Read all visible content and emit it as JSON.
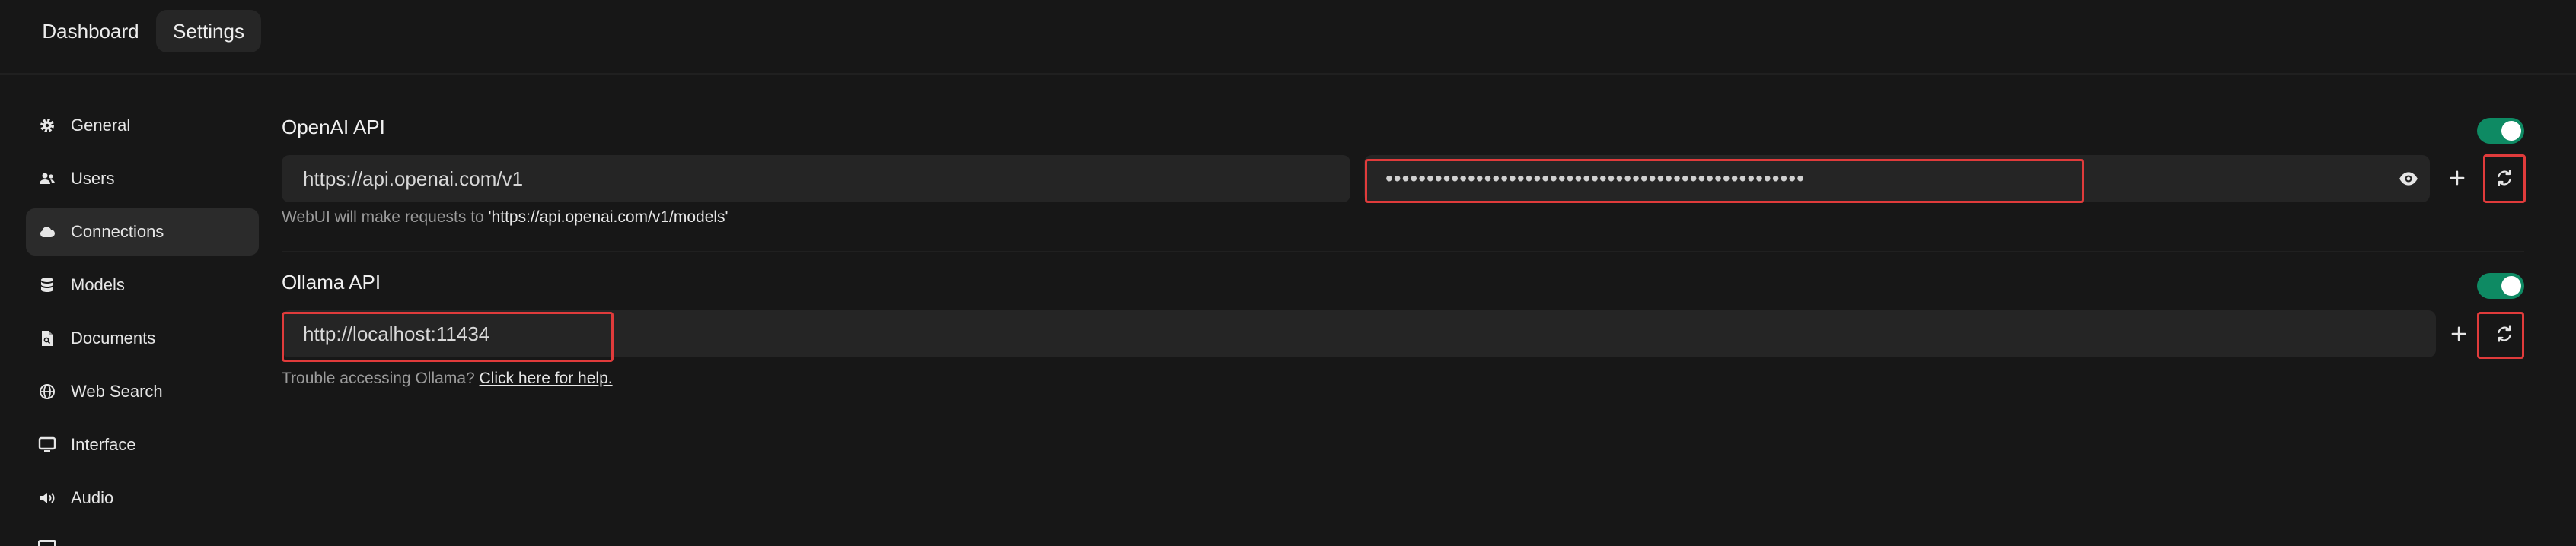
{
  "nav": {
    "tabs": [
      {
        "label": "Dashboard"
      },
      {
        "label": "Settings"
      }
    ]
  },
  "sidebar": {
    "items": [
      {
        "label": "General",
        "icon": "gear-icon"
      },
      {
        "label": "Users",
        "icon": "users-icon"
      },
      {
        "label": "Connections",
        "icon": "cloud-icon"
      },
      {
        "label": "Models",
        "icon": "database-icon"
      },
      {
        "label": "Documents",
        "icon": "document-icon"
      },
      {
        "label": "Web Search",
        "icon": "globe-icon"
      },
      {
        "label": "Interface",
        "icon": "monitor-icon"
      },
      {
        "label": "Audio",
        "icon": "speaker-icon"
      }
    ],
    "active": "Connections"
  },
  "openai": {
    "title": "OpenAI API",
    "enabled": true,
    "url_value": "https://api.openai.com/v1",
    "key_value": "•••••••••••••••••••••••••••••••••••••••••••••••••••",
    "hint_prefix": "WebUI will make requests to ",
    "hint_url": "'https://api.openai.com/v1/models'"
  },
  "ollama": {
    "title": "Ollama API",
    "enabled": true,
    "url_value": "http://localhost:11434",
    "hint_prefix": "Trouble accessing Ollama? ",
    "hint_link": "Click here for help."
  },
  "colors": {
    "background": "#171717",
    "accent": "#0e8a63",
    "highlight": "#e03b3b"
  }
}
